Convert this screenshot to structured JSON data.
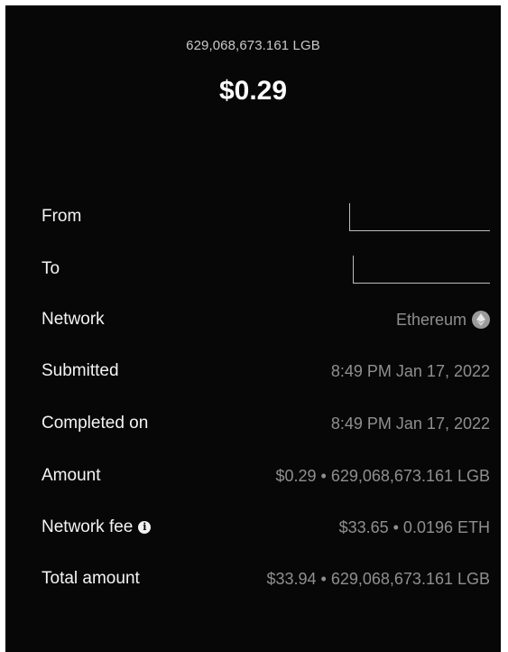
{
  "header": {
    "token_amount": "629,068,673.161 LGB",
    "usd_amount": "$0.29"
  },
  "details": {
    "from": {
      "label": "From",
      "value": ""
    },
    "to": {
      "label": "To",
      "value": ""
    },
    "network": {
      "label": "Network",
      "value": "Ethereum",
      "icon": "ethereum-icon"
    },
    "submitted": {
      "label": "Submitted",
      "value": "8:49 PM Jan 17, 2022"
    },
    "completed": {
      "label": "Completed on",
      "value": "8:49 PM Jan 17, 2022"
    },
    "amount": {
      "label": "Amount",
      "value": "$0.29 • 629,068,673.161 LGB"
    },
    "network_fee": {
      "label": "Network fee",
      "value": "$33.65 • 0.0196 ETH",
      "icon": "info-icon"
    },
    "total": {
      "label": "Total amount",
      "value": "$33.94 • 629,068,673.161 LGB"
    }
  },
  "colors": {
    "background": "#070707",
    "label_text": "#f4f4f4",
    "value_text": "#8f8f8f"
  }
}
